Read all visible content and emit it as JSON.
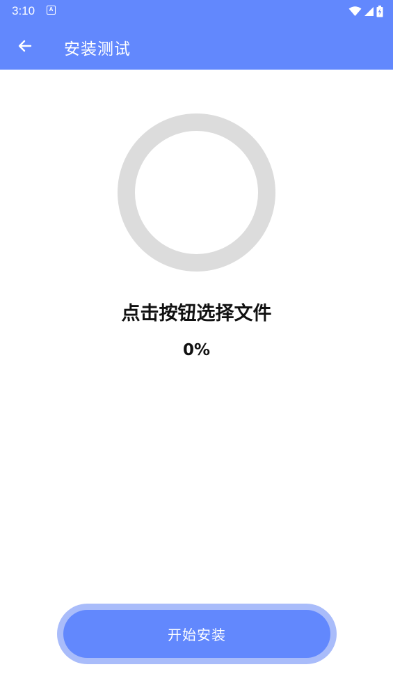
{
  "status_bar": {
    "time": "3:10",
    "notification_glyph": "A",
    "icons": [
      "wifi-icon",
      "cellular-signal-icon",
      "battery-charging-icon"
    ]
  },
  "app_bar": {
    "title": "安装测试",
    "back_icon": "arrow-left-icon"
  },
  "progress": {
    "prompt": "点击按钮选择文件",
    "percent_label": "0%",
    "value": 0,
    "track_color": "#dcdcdc",
    "fill_color": "#6288fd"
  },
  "actions": {
    "install_label": "开始安装"
  },
  "colors": {
    "primary": "#6288fd",
    "button_halo": "#a9bcfa",
    "text": "#111111",
    "background": "#ffffff"
  }
}
